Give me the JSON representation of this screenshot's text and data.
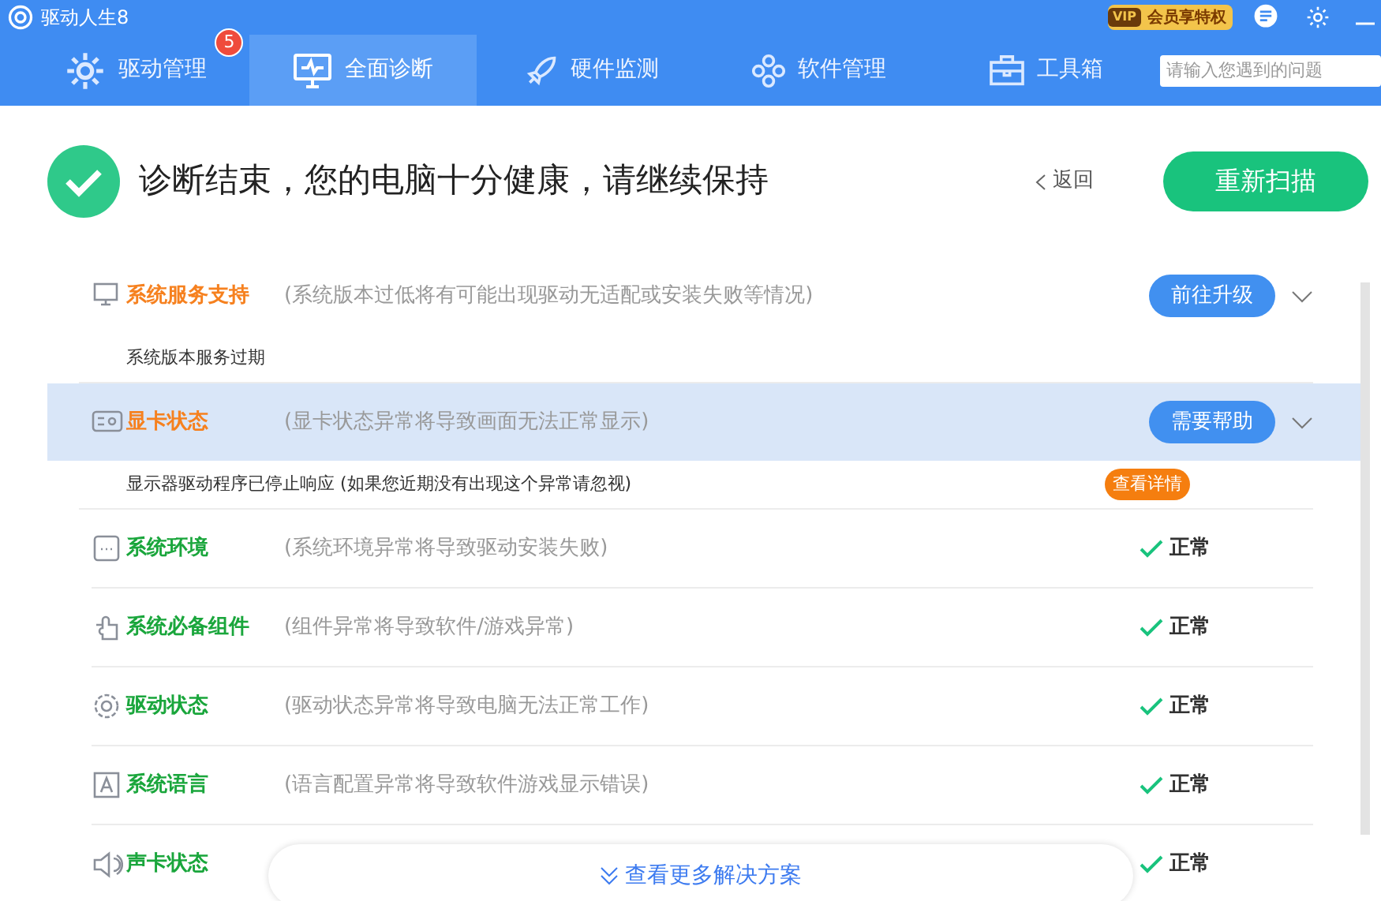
{
  "window": {
    "title": "驱动人生8",
    "vip_badge": {
      "tag": "VIP",
      "label": "会员享特权"
    }
  },
  "tabs": [
    {
      "label": "驱动管理",
      "selected": false,
      "badge": "5"
    },
    {
      "label": "全面诊断",
      "selected": true
    },
    {
      "label": "硬件监测",
      "selected": false
    },
    {
      "label": "软件管理",
      "selected": false
    },
    {
      "label": "工具箱",
      "selected": false
    }
  ],
  "search": {
    "placeholder": "请输入您遇到的问题"
  },
  "header": {
    "title": "诊断结束，您的电脑十分健康，请继续保持",
    "back": "返回",
    "rescan": "重新扫描"
  },
  "items": [
    {
      "kind": "issue",
      "label": "系统服务支持",
      "description": "(系统版本过低将有可能出现驱动无适配或安装失败等情况)",
      "action": "前往升级",
      "selected": false,
      "detail": "系统版本服务过期"
    },
    {
      "kind": "issue",
      "label": "显卡状态",
      "description": "(显卡状态异常将导致画面无法正常显示)",
      "action": "需要帮助",
      "selected": true,
      "detail": "显示器驱动程序已停止响应 (如果您近期没有出现这个异常请忽视)",
      "detail_action": "查看详情"
    },
    {
      "kind": "ok",
      "label": "系统环境",
      "description": "(系统环境异常将导致驱动安装失败)",
      "status": "正常"
    },
    {
      "kind": "ok",
      "label": "系统必备组件",
      "description": "(组件异常将导致软件/游戏异常)",
      "status": "正常"
    },
    {
      "kind": "ok",
      "label": "驱动状态",
      "description": "(驱动状态异常将导致电脑无法正常工作)",
      "status": "正常"
    },
    {
      "kind": "ok",
      "label": "系统语言",
      "description": "(语言配置异常将导致软件游戏显示错误)",
      "status": "正常"
    },
    {
      "kind": "ok",
      "label": "声卡状态",
      "status": "正常"
    }
  ],
  "more_button": "查看更多解决方案"
}
